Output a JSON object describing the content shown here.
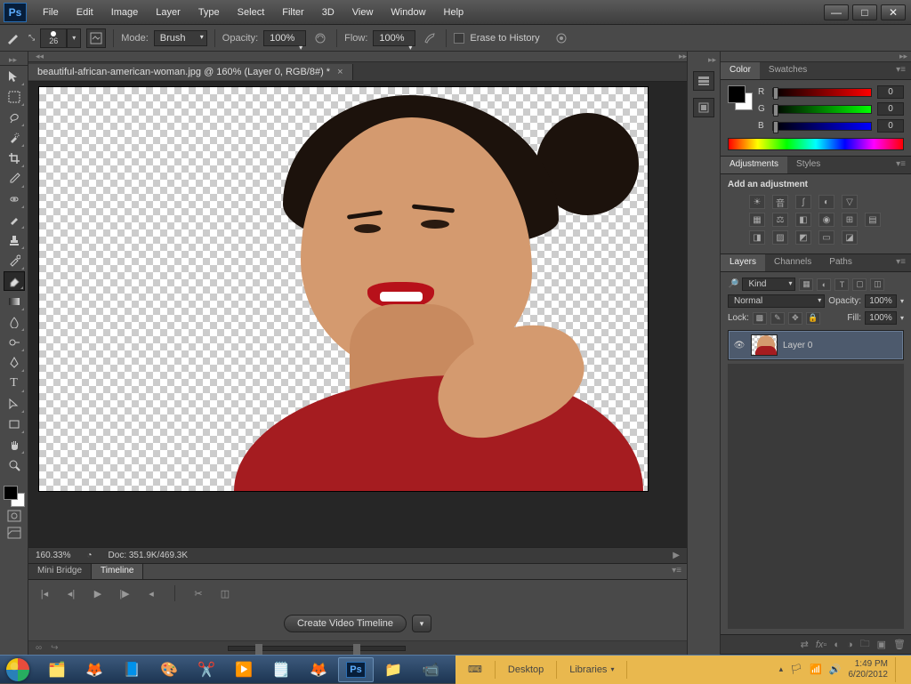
{
  "menu": [
    "File",
    "Edit",
    "Image",
    "Layer",
    "Type",
    "Select",
    "Filter",
    "3D",
    "View",
    "Window",
    "Help"
  ],
  "options": {
    "brush_size": "26",
    "mode_label": "Mode:",
    "mode_value": "Brush",
    "opacity_label": "Opacity:",
    "opacity_value": "100%",
    "flow_label": "Flow:",
    "flow_value": "100%",
    "erase_history": "Erase to History"
  },
  "document": {
    "tab_title": "beautiful-african-american-woman.jpg @ 160% (Layer 0, RGB/8#) *",
    "zoom": "160.33%",
    "doc_info": "Doc: 351.9K/469.3K"
  },
  "bottom": {
    "tabs": [
      "Mini Bridge",
      "Timeline"
    ],
    "create_timeline": "Create Video Timeline"
  },
  "color": {
    "tabs": [
      "Color",
      "Swatches"
    ],
    "r_label": "R",
    "r_val": "0",
    "g_label": "G",
    "g_val": "0",
    "b_label": "B",
    "b_val": "0"
  },
  "adjustments": {
    "tabs": [
      "Adjustments",
      "Styles"
    ],
    "title": "Add an adjustment"
  },
  "layers": {
    "tabs": [
      "Layers",
      "Channels",
      "Paths"
    ],
    "kind": "Kind",
    "blend": "Normal",
    "opacity_label": "Opacity:",
    "opacity_value": "100%",
    "lock_label": "Lock:",
    "fill_label": "Fill:",
    "fill_value": "100%",
    "layer_name": "Layer 0"
  },
  "taskbar": {
    "desktop": "Desktop",
    "libraries": "Libraries",
    "time": "1:49 PM",
    "date": "6/20/2012"
  }
}
